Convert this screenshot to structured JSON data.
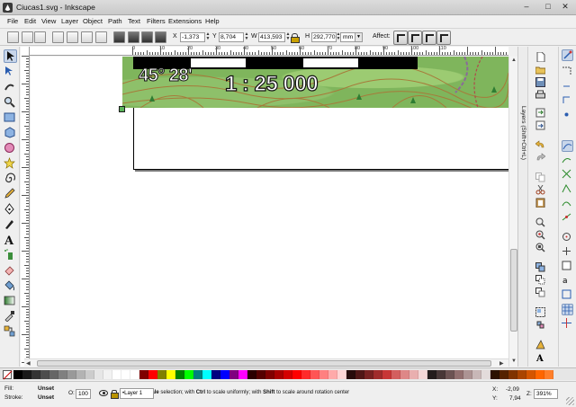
{
  "window": {
    "title": "Ciucas1.svg - Inkscape",
    "min": "–",
    "max": "□",
    "close": "✕"
  },
  "menu": [
    "File",
    "Edit",
    "View",
    "Layer",
    "Object",
    "Path",
    "Text",
    "Filters",
    "Extensions",
    "Help"
  ],
  "controls": {
    "x_label": "X",
    "x_value": "-1,373",
    "y_label": "Y",
    "y_value": "8,704",
    "w_label": "W",
    "w_value": "413,593",
    "h_label": "H",
    "h_value": "292,770",
    "unit": "mm",
    "affect_label": "Affect:"
  },
  "ruler": {
    "top_labels": [
      "0",
      "10",
      "20",
      "30",
      "40",
      "50",
      "60",
      "70",
      "80",
      "90",
      "100",
      "110"
    ],
    "dash": "-"
  },
  "canvas": {
    "map_angle_text": "45° 28'",
    "map_scale_text": "1 : 25 000"
  },
  "docks": {
    "layers_tab": "Layers (Shift+Ctrl+L)"
  },
  "palette": {
    "colors": [
      "#000000",
      "#1a1a1a",
      "#333333",
      "#4d4d4d",
      "#666666",
      "#808080",
      "#999999",
      "#b3b3b3",
      "#cccccc",
      "#e6e6e6",
      "#f2f2f2",
      "#ffffff",
      "#ffffff",
      "#ffffff",
      "#800000",
      "#ff0000",
      "#808000",
      "#ffff00",
      "#008000",
      "#00ff00",
      "#008080",
      "#00ffff",
      "#000080",
      "#0000ff",
      "#800080",
      "#ff00ff",
      "#2b0000",
      "#550000",
      "#800000",
      "#aa0000",
      "#d40000",
      "#ff0000",
      "#ff2a2a",
      "#ff5555",
      "#ff8080",
      "#ffaaaa",
      "#ffd5d5",
      "#280b0b",
      "#501616",
      "#782121",
      "#a02c2c",
      "#c83737",
      "#d35f5f",
      "#de8787",
      "#e9afaf",
      "#f4d7d7",
      "#241c1c",
      "#483737",
      "#6c5353",
      "#916f6f",
      "#ac9393",
      "#c8b7b7",
      "#e3dbdb",
      "#2b1100",
      "#552200",
      "#803300",
      "#aa4400",
      "#d45500",
      "#ff6600",
      "#ff7f2a"
    ]
  },
  "status": {
    "fill_label": "Fill:",
    "fill_value": "Unset",
    "stroke_label": "Stroke:",
    "stroke_value": "Unset",
    "opacity_label": "O:",
    "opacity_value": "100",
    "layer": "•Layer 1",
    "message_bold1": "Scale",
    "message_part1": " selection; with ",
    "message_bold2": "Ctrl",
    "message_part2": " to scale uniformly; with ",
    "message_bold3": "Shift",
    "message_part3": " to scale around rotation center",
    "x_label": "X:",
    "x_value": "-2,09",
    "y_label": "Y:",
    "y_value": "7,94",
    "z_label": "Z:",
    "zoom_value": "391%"
  }
}
